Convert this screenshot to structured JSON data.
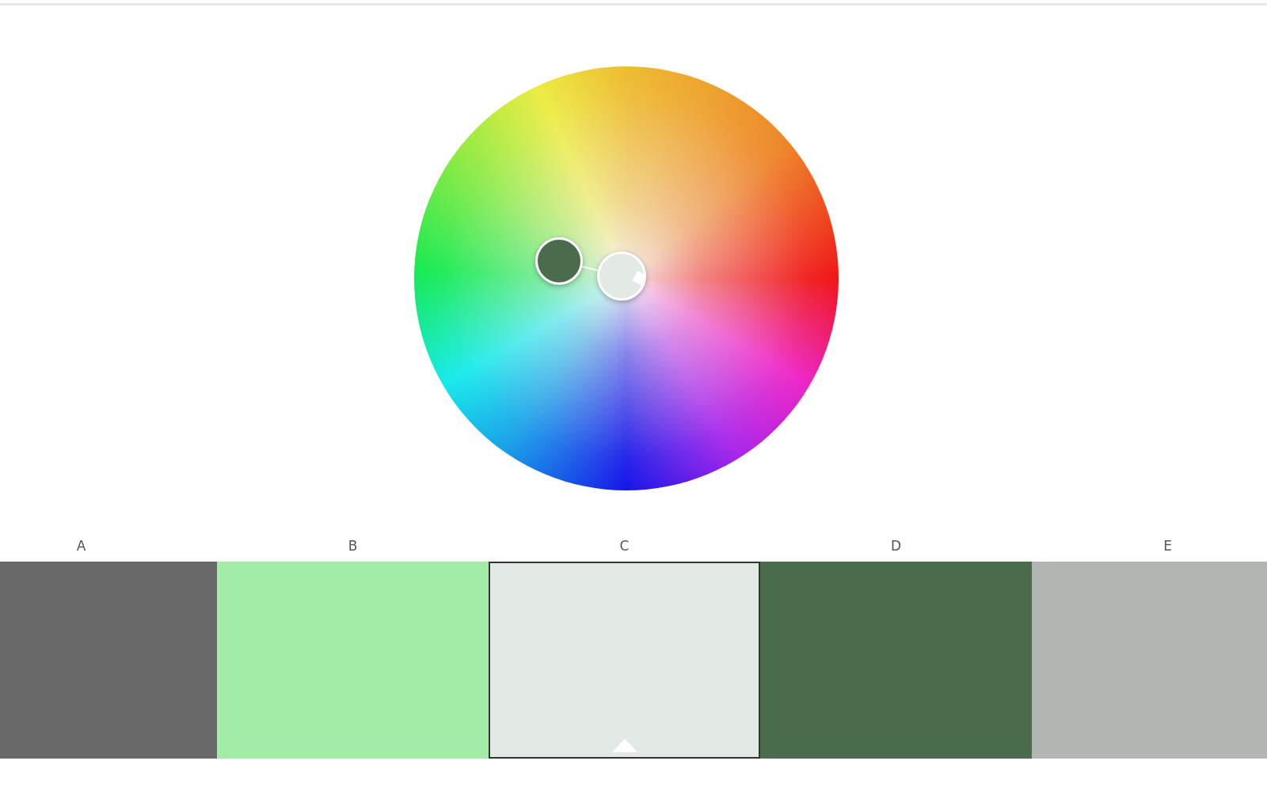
{
  "color_wheel": {
    "handles": [
      {
        "color": "#4a6b4c",
        "selected": false
      },
      {
        "color": "#e3e9e4",
        "selected": true
      }
    ]
  },
  "swatches": [
    {
      "label": "A",
      "color": "#686968",
      "selected": false
    },
    {
      "label": "B",
      "color": "#a3eca8",
      "selected": false
    },
    {
      "label": "C",
      "color": "#e3e9e4",
      "selected": true
    },
    {
      "label": "D",
      "color": "#4a6b4c",
      "selected": false
    },
    {
      "label": "E",
      "color": "#b2b6b3",
      "selected": false
    }
  ]
}
